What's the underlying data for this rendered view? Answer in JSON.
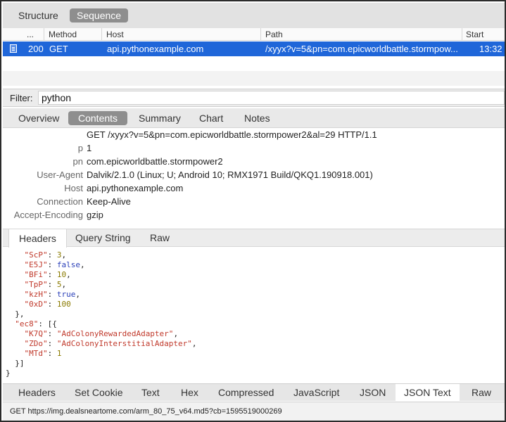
{
  "view_tabs": [
    "Structure",
    "Sequence"
  ],
  "active_view_tab": "Sequence",
  "table": {
    "columns": [
      "...",
      "Method",
      "Host",
      "Path",
      "Start"
    ],
    "rows": [
      {
        "status": "200",
        "method": "GET",
        "host": "api.pythonexample.com",
        "path": "/xyyx?v=5&pn=com.epicworldbattle.stormpow...",
        "start": "13:32",
        "selected": true
      }
    ]
  },
  "filter": {
    "label": "Filter:",
    "value": "python"
  },
  "inspector_tabs": [
    "Overview",
    "Contents",
    "Summary",
    "Chart",
    "Notes"
  ],
  "active_inspector_tab": "Contents",
  "request": {
    "request_line": "GET /xyyx?v=5&pn=com.epicworldbattle.stormpower2&al=29 HTTP/1.1",
    "headers": [
      {
        "name": "p",
        "value": "1"
      },
      {
        "name": "pn",
        "value": "com.epicworldbattle.stormpower2"
      },
      {
        "name": "User-Agent",
        "value": "Dalvik/2.1.0 (Linux; U; Android 10; RMX1971 Build/QKQ1.190918.001)"
      },
      {
        "name": "Host",
        "value": "api.pythonexample.com"
      },
      {
        "name": "Connection",
        "value": "Keep-Alive"
      },
      {
        "name": "Accept-Encoding",
        "value": "gzip"
      }
    ]
  },
  "sub_tabs": [
    "Headers",
    "Query String",
    "Raw"
  ],
  "active_sub_tab": "Headers",
  "json_lines": [
    [
      [
        "jkey",
        "    \"ScP\""
      ],
      [
        "jpunc",
        ": "
      ],
      [
        "jnum",
        "3"
      ],
      [
        "jpunc",
        ","
      ]
    ],
    [
      [
        "jkey",
        "    \"E5J\""
      ],
      [
        "jpunc",
        ": "
      ],
      [
        "jbool",
        "false"
      ],
      [
        "jpunc",
        ","
      ]
    ],
    [
      [
        "jkey",
        "    \"BFi\""
      ],
      [
        "jpunc",
        ": "
      ],
      [
        "jnum",
        "10"
      ],
      [
        "jpunc",
        ","
      ]
    ],
    [
      [
        "jkey",
        "    \"TpP\""
      ],
      [
        "jpunc",
        ": "
      ],
      [
        "jnum",
        "5"
      ],
      [
        "jpunc",
        ","
      ]
    ],
    [
      [
        "jkey",
        "    \"kzH\""
      ],
      [
        "jpunc",
        ": "
      ],
      [
        "jbool",
        "true"
      ],
      [
        "jpunc",
        ","
      ]
    ],
    [
      [
        "jkey",
        "    \"0xD\""
      ],
      [
        "jpunc",
        ": "
      ],
      [
        "jnum",
        "100"
      ]
    ],
    [
      [
        "jpunc",
        "  },"
      ]
    ],
    [
      [
        "jkey",
        "  \"ec8\""
      ],
      [
        "jpunc",
        ": [{"
      ]
    ],
    [
      [
        "jkey",
        "    \"K7Q\""
      ],
      [
        "jpunc",
        ": "
      ],
      [
        "jstr",
        "\"AdColonyRewardedAdapter\""
      ],
      [
        "jpunc",
        ","
      ]
    ],
    [
      [
        "jkey",
        "    \"ZDo\""
      ],
      [
        "jpunc",
        ": "
      ],
      [
        "jstr",
        "\"AdColonyInterstitialAdapter\""
      ],
      [
        "jpunc",
        ","
      ]
    ],
    [
      [
        "jkey",
        "    \"MTd\""
      ],
      [
        "jpunc",
        ": "
      ],
      [
        "jnum",
        "1"
      ]
    ],
    [
      [
        "jpunc",
        "  }]"
      ]
    ],
    [
      [
        "jpunc",
        "}"
      ]
    ]
  ],
  "bottom_tabs": [
    "Headers",
    "Set Cookie",
    "Text",
    "Hex",
    "Compressed",
    "JavaScript",
    "JSON",
    "JSON Text",
    "Raw"
  ],
  "active_bottom_tab": "JSON Text",
  "status_bar": "GET https://img.dealsneartome.com/arm_80_75_v64.md5?cb=1595519000269",
  "colors": {
    "selection": "#1f66d9",
    "active_tab": "#8e8e8e",
    "json_key": "#c0392b",
    "json_number": "#8a7a00",
    "json_bool": "#2a3fb8"
  }
}
